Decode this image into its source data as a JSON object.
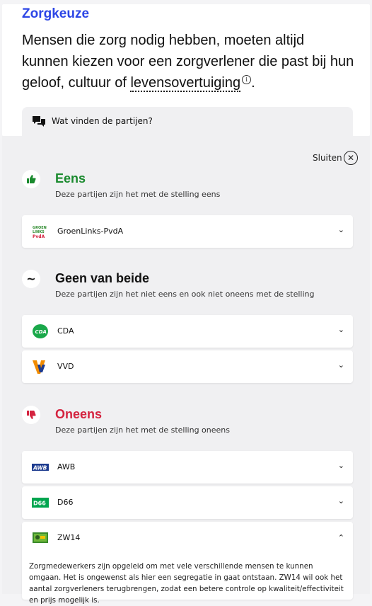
{
  "topic": {
    "title": "Zorgkeuze",
    "statement_prefix": "Mensen die zorg nodig hebben, moeten altijd kunnen kiezen voor een zorgverlener die past bij hun geloof, cultuur of",
    "statement_term": "levensovertuiging",
    "statement_suffix": "."
  },
  "parties_tab": {
    "label": "Wat vinden de partijen?",
    "icon": "chat-bubbles-icon"
  },
  "close": {
    "label": "Sluiten",
    "icon": "close-circle-icon"
  },
  "groups": [
    {
      "title": "Eens",
      "description": "Deze partijen zijn het met de stelling eens",
      "color": "#1a8a2e",
      "icon": "thumbs-up-icon",
      "parties": [
        {
          "name": "GroenLinks-PvdA",
          "logo": "groenlinks-pvda-logo"
        }
      ]
    },
    {
      "title": "Geen van beide",
      "description": "Deze partijen zijn het niet eens en ook niet oneens met de stelling",
      "color": "#111111",
      "icon": "tilde-icon",
      "parties": [
        {
          "name": "CDA",
          "logo": "cda-logo"
        },
        {
          "name": "VVD",
          "logo": "vvd-logo"
        }
      ]
    },
    {
      "title": "Oneens",
      "description": "Deze partijen zijn het met de stelling oneens",
      "color": "#d4233f",
      "icon": "thumbs-down-icon",
      "parties": [
        {
          "name": "AWB",
          "logo": "awb-logo"
        },
        {
          "name": "D66",
          "logo": "d66-logo"
        },
        {
          "name": "ZW14",
          "logo": "zw14-logo",
          "expanded": true,
          "explanation": "Zorgmedewerkers zijn opgeleid om met vele verschillende mensen te kunnen omgaan. Het is ongewenst als hier een segregatie in gaat ontstaan. ZW14 wil ook het aantal zorgverleners terugbrengen, zodat een betere controle op kwaliteit/effectiviteit en prijs mogelijk is."
        }
      ]
    }
  ]
}
